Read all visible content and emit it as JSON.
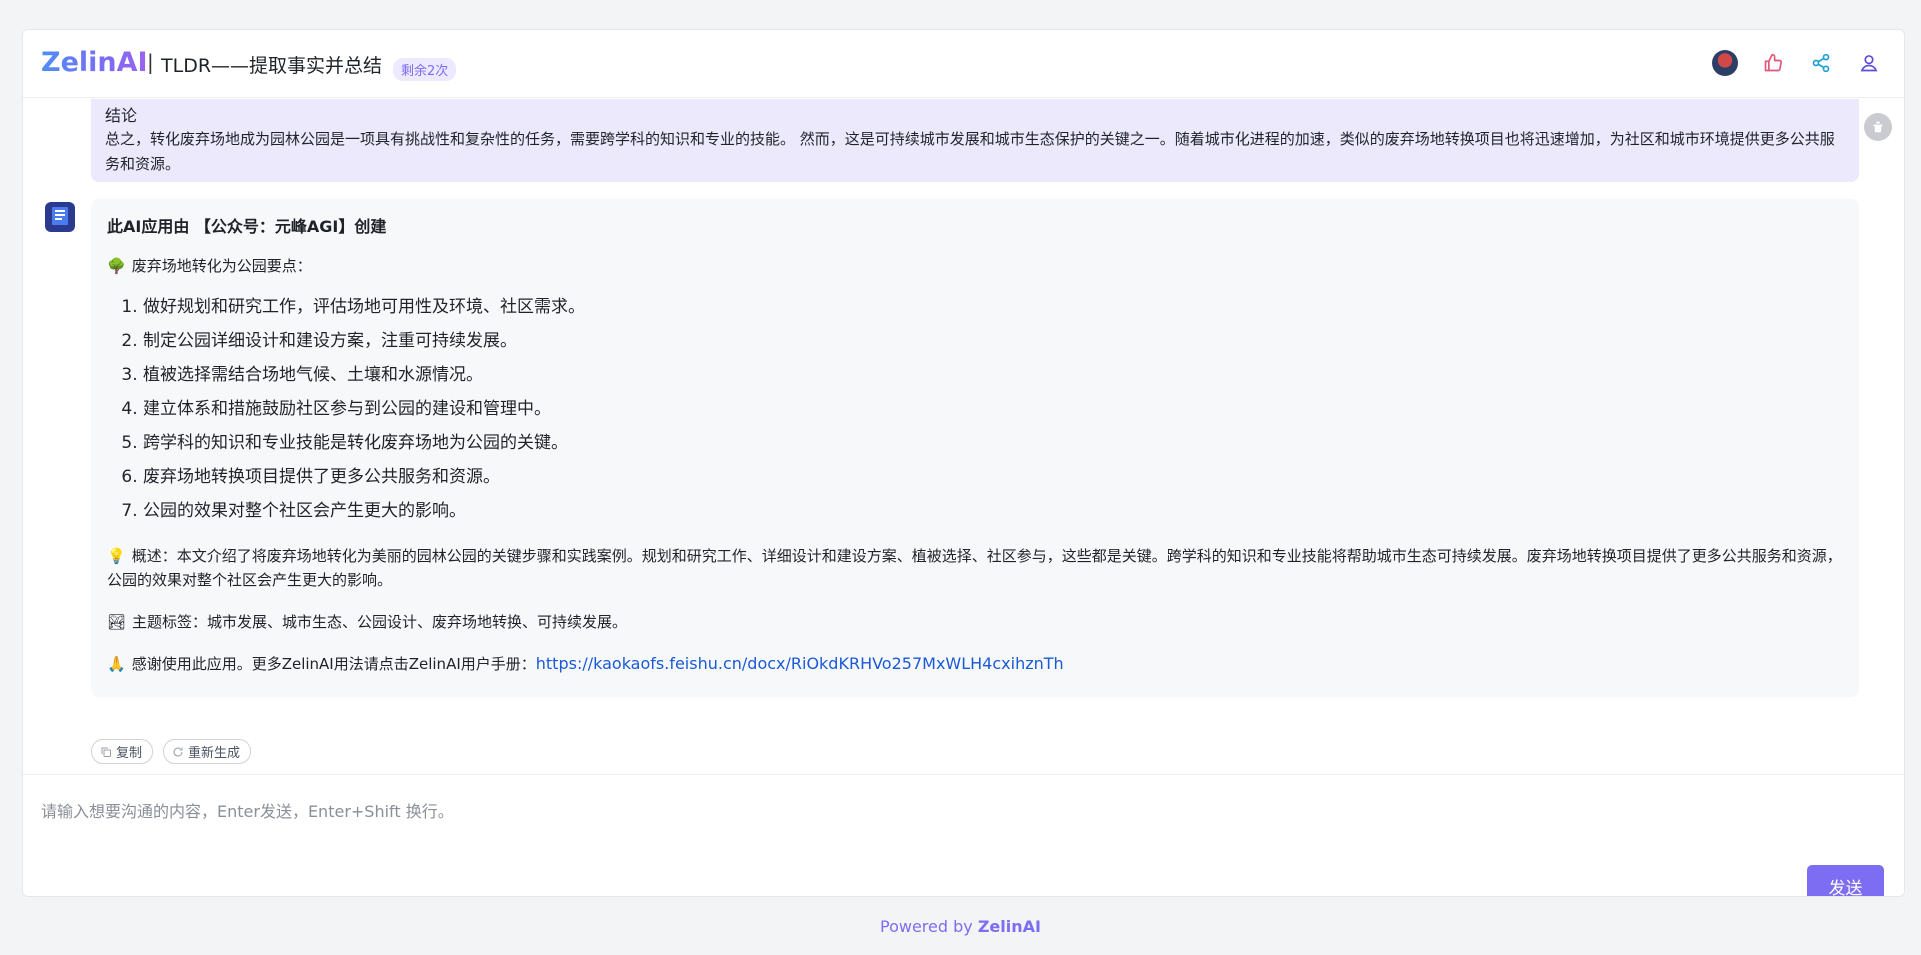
{
  "header": {
    "logo": "ZelinAI",
    "separator": "|",
    "title": "TLDR——提取事实并总结",
    "remaining": "剩余2次",
    "icons": [
      "user-avatar-icon",
      "thumbs-up-icon",
      "share-icon",
      "user-icon"
    ]
  },
  "conclusion": {
    "heading": "结论",
    "text": "总之，转化废弃场地成为园林公园是一项具有挑战性和复杂性的任务，需要跨学科的知识和专业的技能。 然而，这是可持续城市发展和城市生态保护的关键之一。随着城市化进程的加速，类似的废弃场地转换项目也将迅速增加，为社区和城市环境提供更多公共服务和资源。"
  },
  "reply": {
    "heading": "此AI应用由 【公众号：元峰AGI】创建",
    "points_emoji": "🌳",
    "points_title": "废弃场地转化为公园要点：",
    "points": [
      "做好规划和研究工作，评估场地可用性及环境、社区需求。",
      "制定公园详细设计和建设方案，注重可持续发展。",
      "植被选择需结合场地气候、土壤和水源情况。",
      "建立体系和措施鼓励社区参与到公园的建设和管理中。",
      "跨学科的知识和专业技能是转化废弃场地为公园的关键。",
      "废弃场地转换项目提供了更多公共服务和资源。",
      "公园的效果对整个社区会产生更大的影响。"
    ],
    "summary_emoji": "💡",
    "summary": "概述：本文介绍了将废弃场地转化为美丽的园林公园的关键步骤和实践案例。规划和研究工作、详细设计和建设方案、植被选择、社区参与，这些都是关键。跨学科的知识和专业技能将帮助城市生态可持续发展。废弃场地转换项目提供了更多公共服务和资源，公园的效果对整个社区会产生更大的影响。",
    "tags_emoji": "🏞",
    "tags": "主题标签：城市发展、城市生态、公园设计、废弃场地转换、可持续发展。",
    "thanks_emoji": "🙏",
    "thanks": "感谢使用此应用。更多ZelinAI用法请点击ZelinAI用户手册：",
    "link": "https://kaokaofs.feishu.cn/docx/RiOkdKRHVo257MxWLH4cxihznTh"
  },
  "actions": {
    "copy": "复制",
    "regenerate": "重新生成"
  },
  "input": {
    "placeholder": "请输入想要沟通的内容，Enter发送，Enter+Shift 换行。",
    "send": "发送"
  },
  "footer": {
    "powered_by": "Powered by",
    "brand": "ZelinAI"
  },
  "colors": {
    "accent": "#7d6df2",
    "badge_bg": "#ede9fe",
    "conclusion_bg": "#ece9fc",
    "link": "#1a5ad7"
  }
}
